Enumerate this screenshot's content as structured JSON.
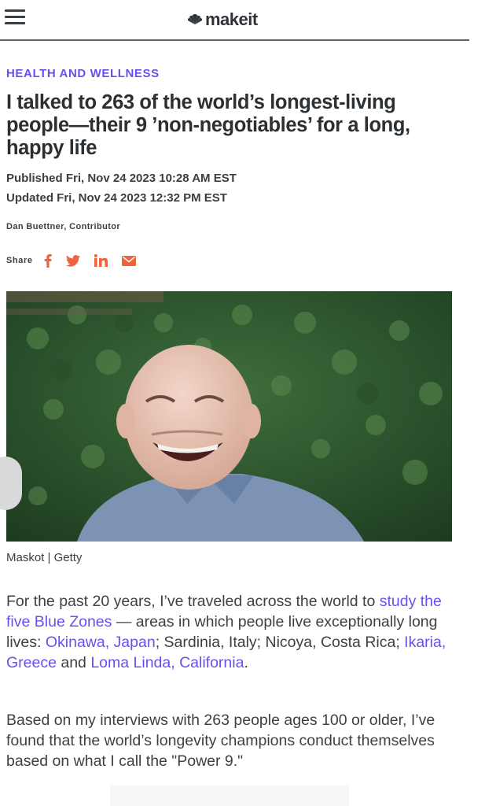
{
  "header": {
    "logo_text": "make",
    "logo_text_it": "it",
    "menu_icon": "hamburger-menu-icon",
    "logo_icon": "nbc-peacock-icon"
  },
  "article": {
    "category": "HEALTH AND WELLNESS",
    "title": "I talked to 263 of the world’s longest-living people—their 9 ’non-negotiables’ for a long, happy life",
    "published": "Published Fri, Nov 24 2023 10:28 AM EST",
    "updated": "Updated Fri, Nov 24 2023 12:32 PM EST",
    "byline": "Dan Buettner, Contributor",
    "share": {
      "label": "Share",
      "icons": [
        "facebook-icon",
        "twitter-icon",
        "linkedin-icon",
        "email-icon"
      ]
    },
    "image_caption": "Maskot | Getty",
    "paragraph1": {
      "t1": "For the past 20 years, I’ve traveled across the world to ",
      "link1": "study the five Blue Zones",
      "t2": " — areas in which people live exceptionally long lives: ",
      "link2": "Okinawa, Japan",
      "t3": "; Sardinia, Italy; Nicoya, Costa Rica; ",
      "link3": "Ikaria, Greece",
      "t4": " and ",
      "link4": "Loma Linda, California",
      "t5": "."
    },
    "paragraph2": "Based on my interviews with 263 people ages 100 or older, I’ve found that the world’s longevity champions conduct themselves based on what I call the \"Power 9.\""
  },
  "colors": {
    "accent": "#6a4ff0",
    "share_icons": "#f0623c",
    "text": "#3c4146"
  }
}
